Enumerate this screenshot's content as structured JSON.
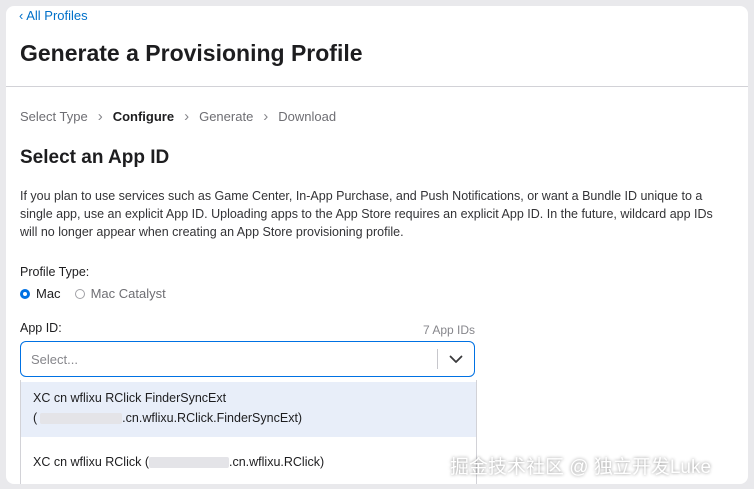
{
  "nav": {
    "back_label": "All Profiles"
  },
  "header": {
    "title": "Generate a Provisioning Profile"
  },
  "steps": [
    {
      "label": "Select Type"
    },
    {
      "label": "Configure"
    },
    {
      "label": "Generate"
    },
    {
      "label": "Download"
    }
  ],
  "current_step": "Configure",
  "section": {
    "title": "Select an App ID",
    "description": "If you plan to use services such as Game Center, In-App Purchase, and Push Notifications, or want a Bundle ID unique to a single app, use an explicit App ID. Uploading apps to the App Store requires an explicit App ID. In the future, wildcard app IDs will no longer appear when creating an App Store provisioning profile."
  },
  "profile_type": {
    "label": "Profile Type:",
    "options": [
      {
        "label": "Mac",
        "checked": true
      },
      {
        "label": "Mac Catalyst",
        "checked": false
      }
    ]
  },
  "app_id": {
    "label": "App ID:",
    "count": "7 App IDs",
    "placeholder": "Select...",
    "options": [
      {
        "name": "XC cn wflixu RClick FinderSyncExt",
        "open": "(",
        "bundle_suffix": ".cn.wflixu.RClick.FinderSyncExt)",
        "highlighted": true
      },
      {
        "name": "XC cn wflixu RClick (",
        "bundle_suffix": ".cn.wflixu.RClick)",
        "highlighted": false
      }
    ]
  },
  "watermark": "掘金技术社区 @ 独立开发Luke",
  "colors": {
    "accent": "#0071e3",
    "link": "#0070c9",
    "highlight": "#e8eef9"
  }
}
